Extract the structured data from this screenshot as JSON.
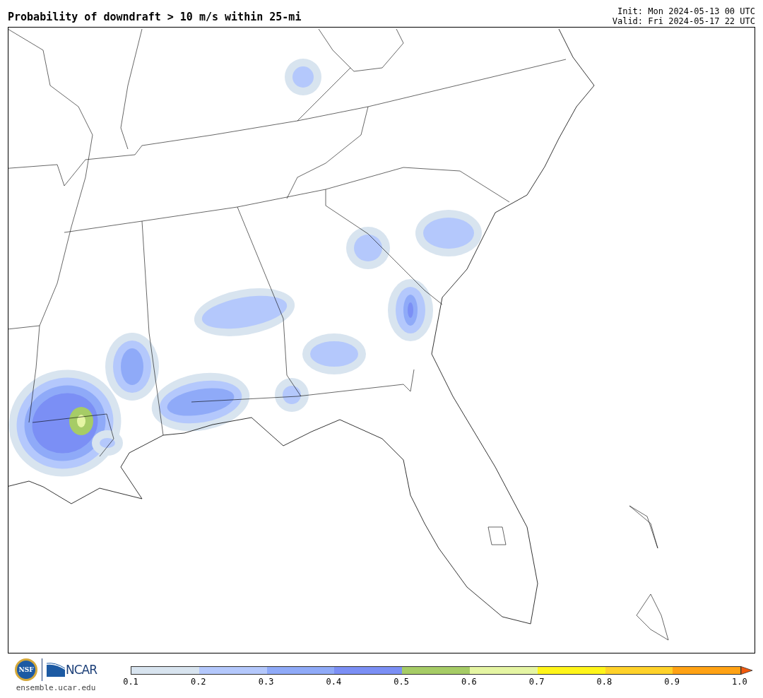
{
  "title": "Probability of downdraft > 10 m/s within 25-mi",
  "init": "Init: Mon 2024-05-13 00 UTC",
  "valid": "Valid: Fri 2024-05-17 22 UTC",
  "footer": {
    "seal_text": "NSF",
    "logo_text": "NCAR",
    "site": "ensemble.ucar.edu"
  },
  "colorbar": {
    "segments": [
      {
        "kind": "band",
        "color": "#d8e4ef"
      },
      {
        "kind": "band",
        "color": "#b4c8fc"
      },
      {
        "kind": "band",
        "color": "#8faaf8"
      },
      {
        "kind": "band",
        "color": "#7b8ff5"
      },
      {
        "kind": "band",
        "color": "#a6cc66"
      },
      {
        "kind": "band",
        "color": "#e5f5a3"
      },
      {
        "kind": "band",
        "color": "#fff51a"
      },
      {
        "kind": "band",
        "color": "#ffd22a"
      },
      {
        "kind": "band",
        "color": "#ffa214"
      },
      {
        "kind": "arrow",
        "color": "#f25a0c"
      }
    ],
    "ticks": [
      "0.1",
      "0.2",
      "0.3",
      "0.4",
      "0.5",
      "0.6",
      "0.7",
      "0.8",
      "0.9",
      "1.0"
    ]
  }
}
